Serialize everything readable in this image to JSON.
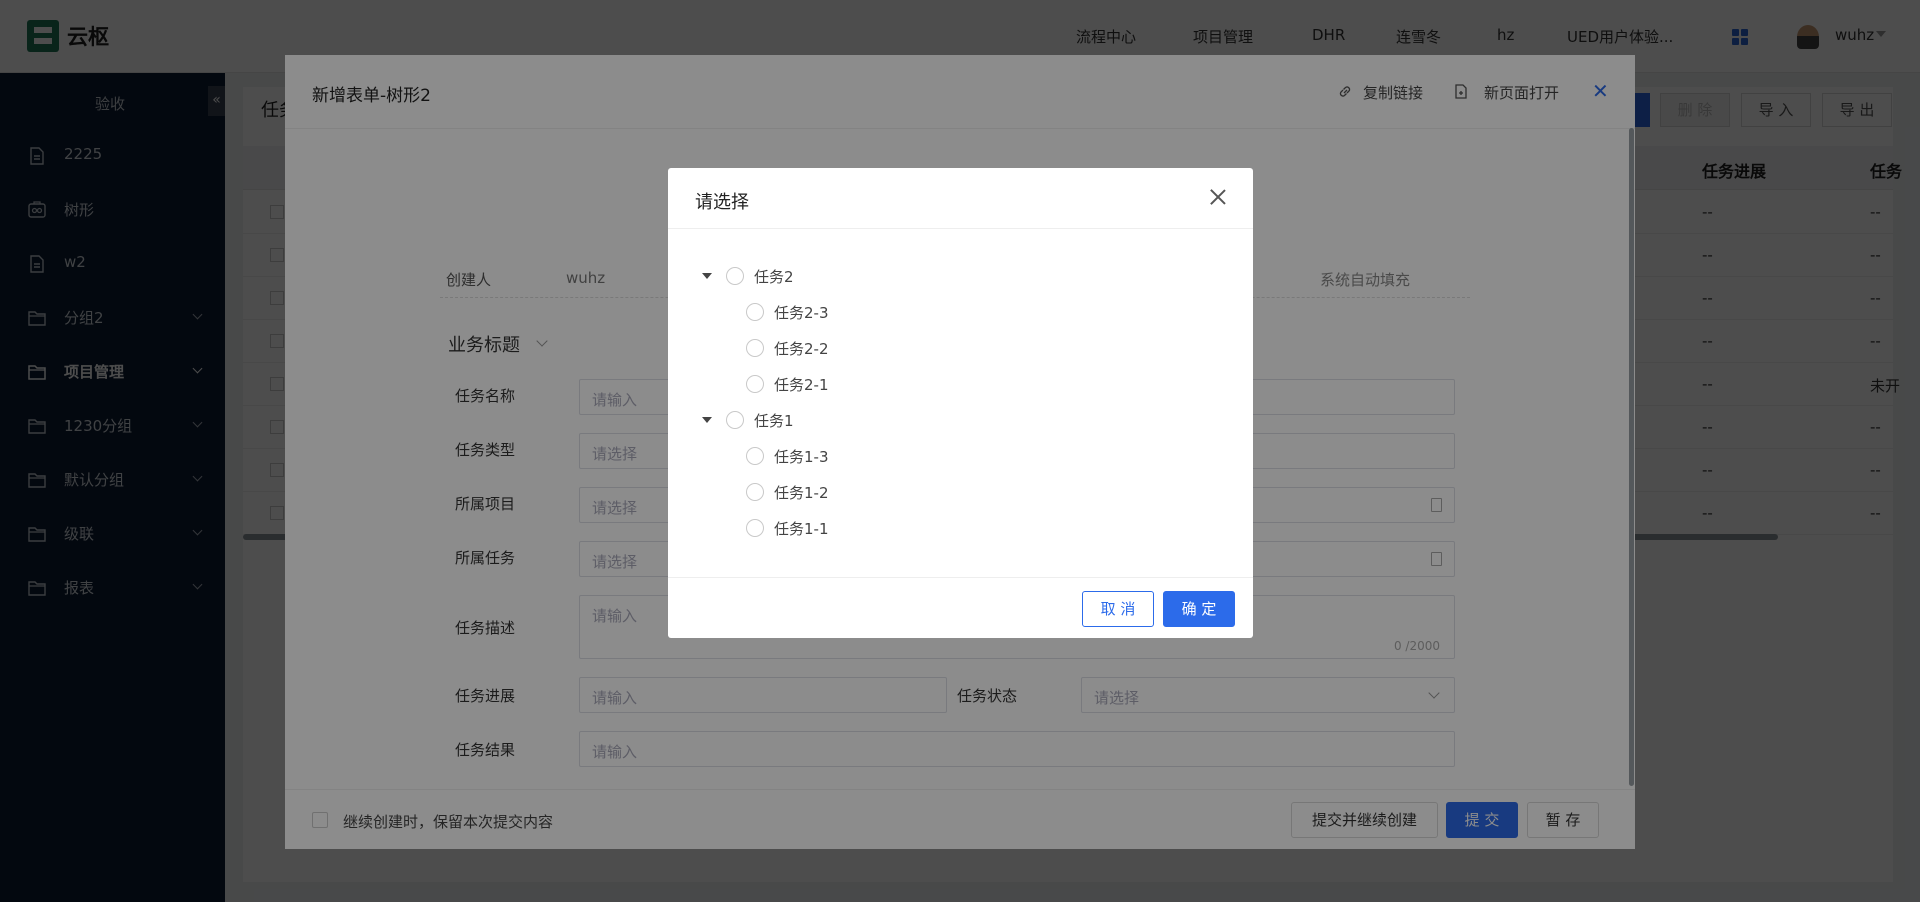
{
  "app": {
    "logo_text": "云枢",
    "user_name": "wuhz"
  },
  "top_nav": [
    "流程中心",
    "项目管理",
    "DHR",
    "连雪冬",
    "hz",
    "UED用户体验..."
  ],
  "sidebar": {
    "title": "验收",
    "collapse_glyph": "«",
    "items": [
      {
        "label": "2225",
        "icon": "document-icon",
        "expandable": false
      },
      {
        "label": "树形",
        "icon": "tree-form-icon",
        "expandable": false
      },
      {
        "label": "w2",
        "icon": "document-icon",
        "expandable": false
      },
      {
        "label": "分组2",
        "icon": "folder-icon",
        "expandable": true
      },
      {
        "label": "项目管理",
        "icon": "folder-icon",
        "expandable": true,
        "active": true
      },
      {
        "label": "1230分组",
        "icon": "folder-icon",
        "expandable": true
      },
      {
        "label": "默认分组",
        "icon": "folder-icon",
        "expandable": true
      },
      {
        "label": "级联",
        "icon": "folder-icon",
        "expandable": true
      },
      {
        "label": "报表",
        "icon": "folder-icon",
        "expandable": true
      }
    ]
  },
  "background_page": {
    "title_fragment": "任务",
    "buttons": {
      "delete": "删 除",
      "import": "导 入",
      "export": "导 出"
    },
    "columns": [
      "任务进展",
      "任务"
    ],
    "rows": [
      [
        "--",
        "--"
      ],
      [
        "--",
        "--"
      ],
      [
        "--",
        "--"
      ],
      [
        "--",
        "--"
      ],
      [
        "--",
        "未开"
      ],
      [
        "--",
        "--"
      ],
      [
        "--",
        "--"
      ],
      [
        "--",
        "--"
      ]
    ]
  },
  "drawer": {
    "title": "新增表单-树形2",
    "copy_link": "复制链接",
    "open_new_page": "新页面打开",
    "creator_label": "创建人",
    "creator_value": "wuhz",
    "auto_fill": "系统自动填充",
    "section_title": "业务标题",
    "fields": {
      "task_name": {
        "label": "任务名称",
        "placeholder": "请输入"
      },
      "task_type": {
        "label": "任务类型",
        "placeholder": "请选择"
      },
      "project": {
        "label": "所属项目",
        "placeholder": "请选择"
      },
      "parent_task": {
        "label": "所属任务",
        "placeholder": "请选择"
      },
      "description": {
        "label": "任务描述",
        "placeholder": "请输入",
        "counter": "0 /2000"
      },
      "progress": {
        "label": "任务进展",
        "placeholder": "请输入"
      },
      "status": {
        "label": "任务状态",
        "placeholder": "请选择"
      },
      "result": {
        "label": "任务结果",
        "placeholder": "请输入"
      }
    },
    "footer": {
      "keep_content": "继续创建时，保留本次提交内容",
      "submit_continue": "提交并继续创建",
      "submit": "提 交",
      "save_draft": "暂 存"
    }
  },
  "select_modal": {
    "title": "请选择",
    "tree": [
      {
        "label": "任务2",
        "children": [
          "任务2-3",
          "任务2-2",
          "任务2-1"
        ]
      },
      {
        "label": "任务1",
        "children": [
          "任务1-3",
          "任务1-2",
          "任务1-1"
        ]
      }
    ],
    "cancel": "取 消",
    "confirm": "确 定"
  },
  "colors": {
    "primary": "#2c6bea",
    "sidebar_bg": "#0b1c33",
    "logo": "#1f7a5a"
  }
}
